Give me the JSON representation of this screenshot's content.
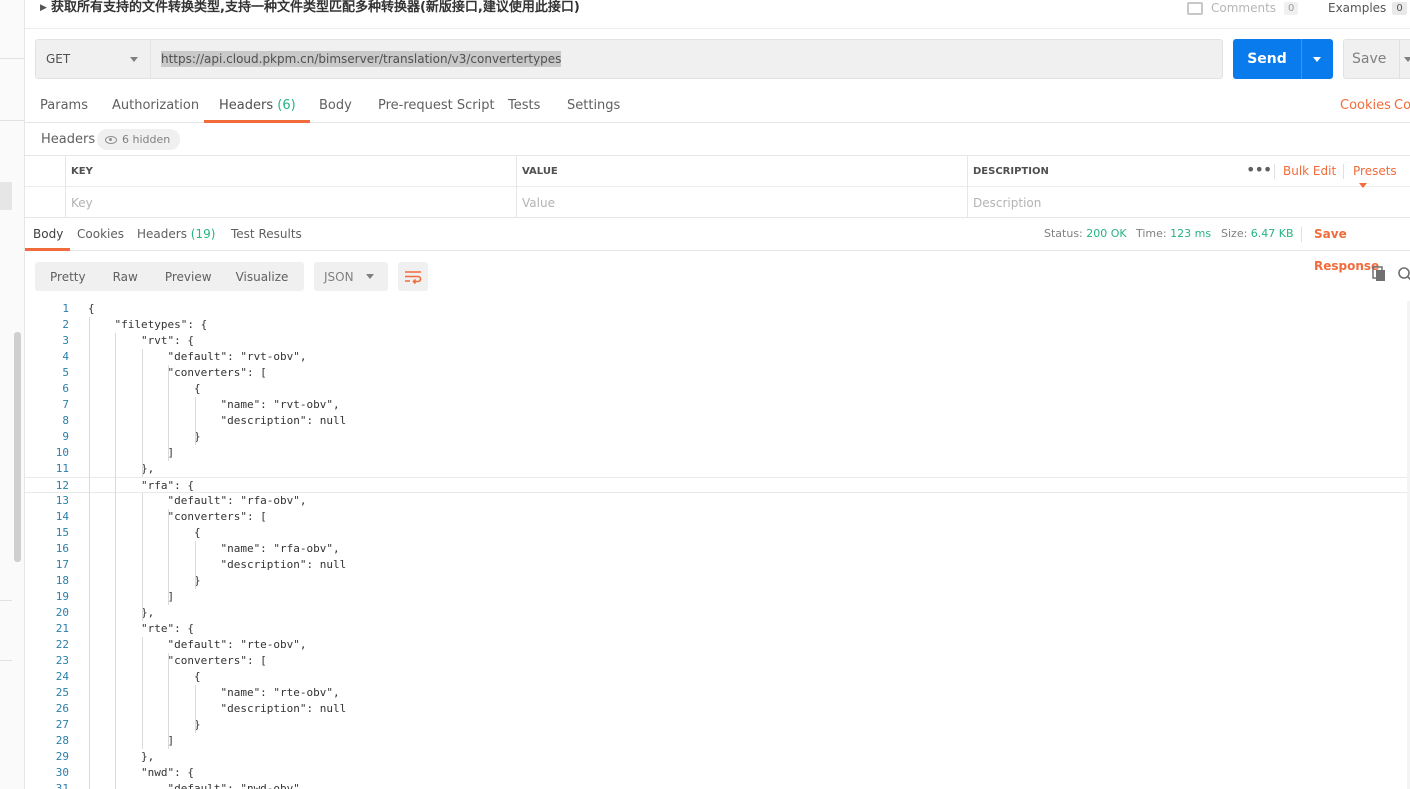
{
  "request": {
    "title": "获取所有支持的文件转换类型,支持一种文件类型匹配多种转换器(新版接口,建议使用此接口)",
    "comments_label": "Comments",
    "comments_count": "0",
    "examples_label": "Examples",
    "examples_count": "0",
    "method": "GET",
    "url": "https://api.cloud.pkpm.cn/bimserver/translation/v3/convertertypes",
    "send_label": "Send",
    "save_label": "Save"
  },
  "request_tabs": {
    "params": "Params",
    "authorization": "Authorization",
    "headers": "Headers",
    "headers_count": "(6)",
    "body": "Body",
    "prerequest": "Pre-request Script",
    "tests": "Tests",
    "settings": "Settings",
    "cookies": "Cookies",
    "code": "Co"
  },
  "headers_panel": {
    "label": "Headers",
    "hidden": "6 hidden",
    "col_key": "KEY",
    "col_value": "VALUE",
    "col_description": "DESCRIPTION",
    "more": "•••",
    "bulk_edit": "Bulk Edit",
    "presets": "Presets",
    "key_placeholder": "Key",
    "value_placeholder": "Value",
    "description_placeholder": "Description"
  },
  "response_tabs": {
    "body": "Body",
    "cookies": "Cookies",
    "headers": "Headers",
    "headers_count": "(19)",
    "test_results": "Test Results",
    "status_label": "Status:",
    "status_value": "200 OK",
    "time_label": "Time:",
    "time_value": "123 ms",
    "size_label": "Size:",
    "size_value": "6.47 KB",
    "save_response": "Save Response"
  },
  "response_toolbar": {
    "pretty": "Pretty",
    "raw": "Raw",
    "preview": "Preview",
    "visualize": "Visualize",
    "format": "JSON"
  },
  "colors": {
    "accent": "#f26b3a",
    "send": "#097bed",
    "success": "#26b47f"
  },
  "icons": [
    "comment-icon",
    "dropdown-arrow-icon",
    "eye-icon",
    "wrap-lines-icon",
    "copy-icon",
    "search-icon"
  ],
  "code_lines": [
    "{",
    "    \"filetypes\": {",
    "        \"rvt\": {",
    "            \"default\": \"rvt-obv\",",
    "            \"converters\": [",
    "                {",
    "                    \"name\": \"rvt-obv\",",
    "                    \"description\": null",
    "                }",
    "            ]",
    "        },",
    "        \"rfa\": {",
    "            \"default\": \"rfa-obv\",",
    "            \"converters\": [",
    "                {",
    "                    \"name\": \"rfa-obv\",",
    "                    \"description\": null",
    "                }",
    "            ]",
    "        },",
    "        \"rte\": {",
    "            \"default\": \"rte-obv\",",
    "            \"converters\": [",
    "                {",
    "                    \"name\": \"rte-obv\",",
    "                    \"description\": null",
    "                }",
    "            ]",
    "        },",
    "        \"nwd\": {",
    "            \"default\": \"nwd-obv\","
  ]
}
